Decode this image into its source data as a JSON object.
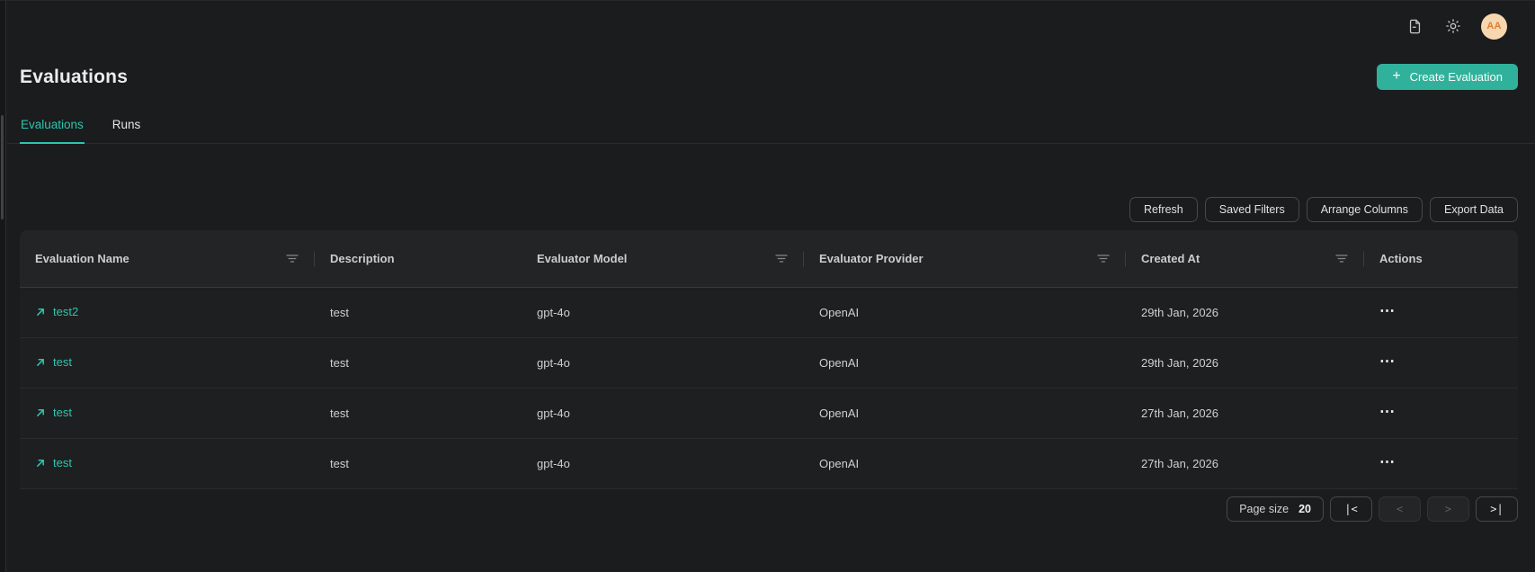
{
  "colors": {
    "page_bg": "#1b1c1d",
    "table_bg": "#1e1f20",
    "header_bg": "#232425",
    "accent_teal": "#2cc5ae",
    "create_button_bg": "#30b19c",
    "avatar_bg": "#f8d7b0",
    "avatar_text": "#dd7e2f"
  },
  "icons": [
    "document-icon",
    "sun-icon",
    "plus-icon",
    "filter-icon",
    "arrow-up-right-icon",
    "ellipsis-icon"
  ],
  "topbar": {
    "avatar_initials": "AA"
  },
  "page_header": {
    "title": "Evaluations",
    "create_button_label": "Create Evaluation",
    "create_button_plus": "+"
  },
  "tabs": [
    {
      "label": "Evaluations",
      "active": true
    },
    {
      "label": "Runs",
      "active": false
    }
  ],
  "toolbar": {
    "refresh": "Refresh",
    "saved_filters": "Saved Filters",
    "arrange_columns": "Arrange Columns",
    "export_data": "Export Data"
  },
  "table": {
    "columns": [
      {
        "label": "Evaluation Name",
        "filterable": true
      },
      {
        "label": "Description",
        "filterable": false
      },
      {
        "label": "Evaluator Model",
        "filterable": true
      },
      {
        "label": "Evaluator Provider",
        "filterable": true
      },
      {
        "label": "Created At",
        "filterable": true
      },
      {
        "label": "Actions",
        "filterable": false
      }
    ],
    "row_actions_ellipsis": "⋯",
    "rows": [
      {
        "name": "test2",
        "description": "test",
        "evaluator_model": "gpt-4o",
        "evaluator_provider": "OpenAI",
        "created_at": "29th Jan, 2026"
      },
      {
        "name": "test",
        "description": "test",
        "evaluator_model": "gpt-4o",
        "evaluator_provider": "OpenAI",
        "created_at": "29th Jan, 2026"
      },
      {
        "name": "test",
        "description": "test",
        "evaluator_model": "gpt-4o",
        "evaluator_provider": "OpenAI",
        "created_at": "27th Jan, 2026"
      },
      {
        "name": "test",
        "description": "test",
        "evaluator_model": "gpt-4o",
        "evaluator_provider": "OpenAI",
        "created_at": "27th Jan, 2026"
      }
    ]
  },
  "pagination": {
    "page_size_label": "Page size",
    "page_size_value": "20",
    "first": "|<",
    "prev": "<",
    "next": ">",
    "last": ">|"
  }
}
